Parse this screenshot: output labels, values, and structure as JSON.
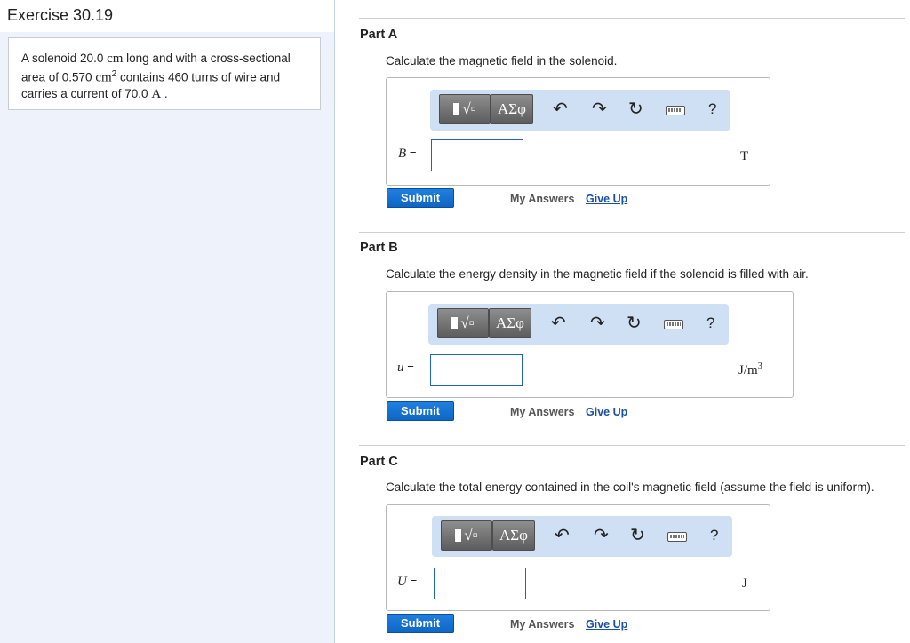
{
  "exercise": {
    "title": "Exercise 30.19",
    "problem": {
      "t1": "A solenoid 20.0 ",
      "u1": "cm",
      "t2": " long and with a cross-sectional area of 0.570 ",
      "u2": "cm",
      "u2_exp": "2",
      "t3": " contains 460 turns of wire and carries a current of 70.0 ",
      "u3": "A",
      "t4": " ."
    }
  },
  "toolbar": {
    "greek_label": "ΑΣφ",
    "undo_icon": "↶",
    "redo_icon": "↷",
    "reset_icon": "↻",
    "help_label": "?"
  },
  "parts": [
    {
      "title": "Part A",
      "question": "Calculate the magnetic field in the solenoid.",
      "variable": "B",
      "eq": "=",
      "unit": "T",
      "unit_exp": "",
      "input_value": "",
      "submit_label": "Submit",
      "my_answers_label": "My Answers",
      "give_up_label": "Give Up"
    },
    {
      "title": "Part B",
      "question": "Calculate the energy density in the magnetic field if the solenoid is filled with air.",
      "variable": "u",
      "eq": "=",
      "unit": "J/m",
      "unit_exp": "3",
      "input_value": "",
      "submit_label": "Submit",
      "my_answers_label": "My Answers",
      "give_up_label": "Give Up"
    },
    {
      "title": "Part C",
      "question": "Calculate the total energy contained in the coil's magnetic field (assume the field is uniform).",
      "variable": "U",
      "eq": "=",
      "unit": "J",
      "unit_exp": "",
      "input_value": "",
      "submit_label": "Submit",
      "my_answers_label": "My Answers",
      "give_up_label": "Give Up"
    }
  ]
}
